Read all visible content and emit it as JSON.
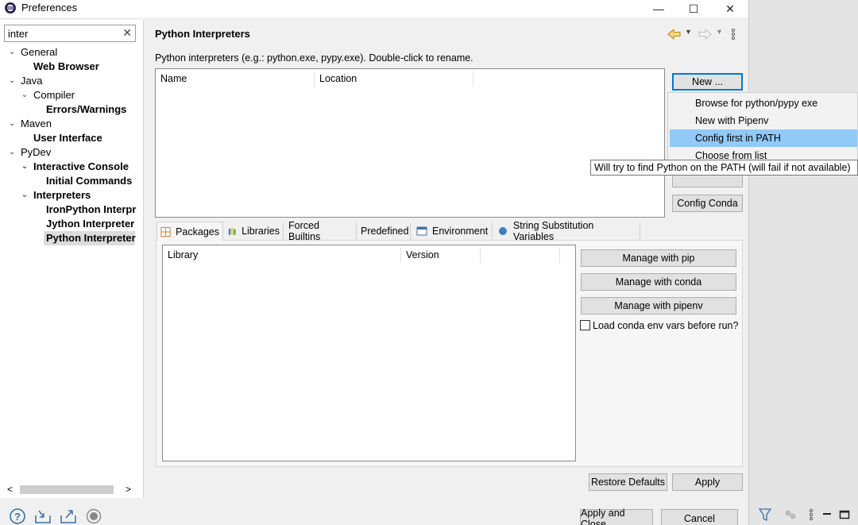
{
  "window": {
    "title": "Preferences",
    "controls": {
      "minimize": "—",
      "maximize": "☐",
      "close": "✕"
    }
  },
  "filter": {
    "value": "inter",
    "clear_glyph": "✕"
  },
  "tree": [
    {
      "label": "General",
      "twisty": "⌄"
    },
    {
      "label": "Web Browser"
    },
    {
      "label": "Java",
      "twisty": "⌄"
    },
    {
      "label": "Compiler",
      "twisty": "⌄"
    },
    {
      "label": "Errors/Warnings"
    },
    {
      "label": "Maven",
      "twisty": "⌄"
    },
    {
      "label": "User Interface"
    },
    {
      "label": "PyDev",
      "twisty": "⌄"
    },
    {
      "label": "Interactive Console",
      "twisty": "⌄"
    },
    {
      "label": "Initial Commands"
    },
    {
      "label": "Interpreters",
      "twisty": "⌄"
    },
    {
      "label": "IronPython Interpre"
    },
    {
      "label": "Jython Interpreter"
    },
    {
      "label": "Python Interpreter"
    }
  ],
  "scroll": {
    "left_arrow": "<",
    "right_arrow": ">"
  },
  "page": {
    "title": "Python Interpreters",
    "description": "Python interpreters (e.g.: python.exe, pypy.exe).   Double-click to rename."
  },
  "interpreters_table": {
    "columns": [
      "Name",
      "Location"
    ]
  },
  "buttons": {
    "new": "New ...",
    "config_conda": "Config Conda",
    "manage_pip": "Manage with pip",
    "manage_conda": "Manage with conda",
    "manage_pipenv": "Manage with pipenv",
    "restore_defaults": "Restore Defaults",
    "apply": "Apply",
    "apply_and_close": "Apply and Close",
    "cancel": "Cancel"
  },
  "new_menu": {
    "items": [
      "Browse for python/pypy exe",
      "New with Pipenv",
      "Config first in PATH",
      "Choose from list"
    ],
    "highlighted_index": 2
  },
  "tooltip": "Will try to find Python on the PATH (will fail if not available)",
  "tabs": [
    "Packages",
    "Libraries",
    "Forced Builtins",
    "Predefined",
    "Environment",
    "String Substitution Variables"
  ],
  "packages_table": {
    "columns": [
      "Library",
      "Version"
    ]
  },
  "checkbox": {
    "label": "Load conda env vars before run?",
    "checked": false
  },
  "colors": {
    "menu_highlight": "#91c9f7",
    "focus_border": "#0078d7",
    "selection": "#dcdcdc"
  }
}
